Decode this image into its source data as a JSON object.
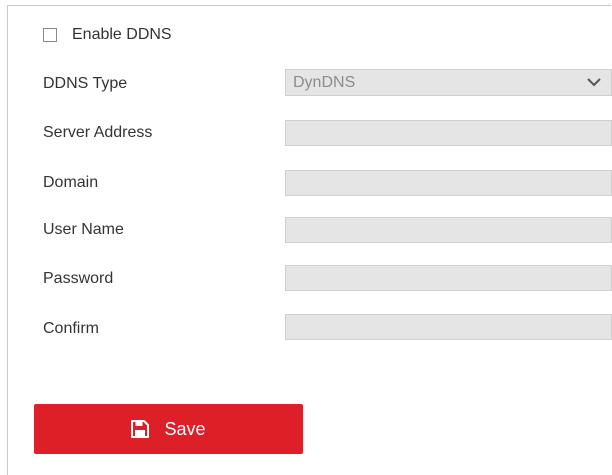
{
  "ddns": {
    "enable_label": "Enable DDNS",
    "enabled": false,
    "type_label": "DDNS Type",
    "type_value": "DynDNS",
    "fields": [
      {
        "label": "Server Address",
        "value": ""
      },
      {
        "label": "Domain",
        "value": ""
      },
      {
        "label": "User Name",
        "value": ""
      },
      {
        "label": "Password",
        "value": ""
      },
      {
        "label": "Confirm",
        "value": ""
      }
    ]
  },
  "actions": {
    "save_label": "Save",
    "save_icon": "floppy-disk-icon",
    "save_color": "#dd2027"
  },
  "colors": {
    "disabled_field_bg": "#e5e5e5",
    "disabled_text": "#8c8c8c"
  }
}
